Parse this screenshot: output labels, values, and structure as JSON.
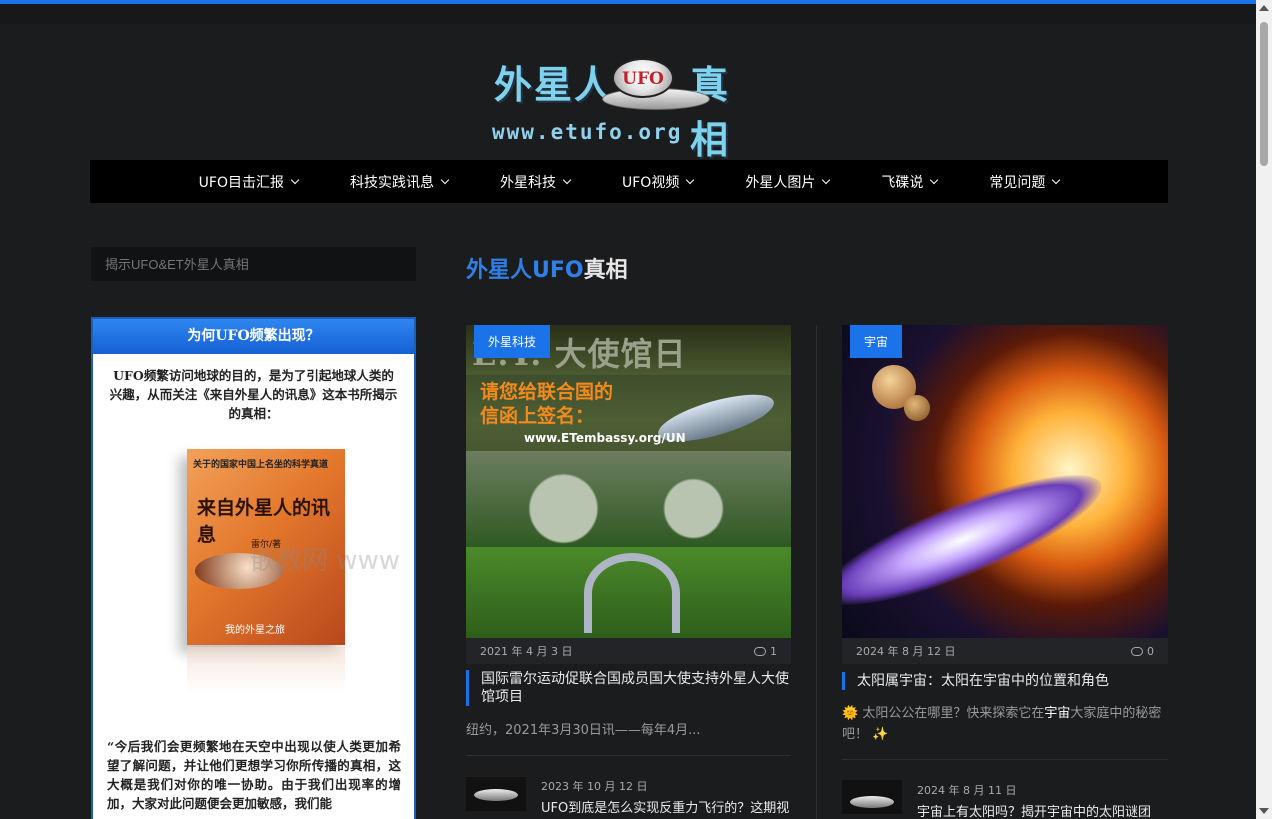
{
  "site": {
    "logo_cn_left": "外星人",
    "logo_badge": "UFO",
    "logo_cn_right": "真相",
    "logo_url": "www.etufo.org"
  },
  "nav": [
    {
      "label": "UFO目击汇报"
    },
    {
      "label": "科技实践讯息"
    },
    {
      "label": "外星科技"
    },
    {
      "label": "UFO视频"
    },
    {
      "label": "外星人图片"
    },
    {
      "label": "飞碟说"
    },
    {
      "label": "常见问题"
    }
  ],
  "sidebar": {
    "search_placeholder": "揭示UFO&ET外星人真相",
    "widget_title": "为何UFO频繁出现？",
    "widget_intro": "UFO频繁访问地球的目的，是为了引起地球人类的兴趣，从而关注《来自外星人的讯息》这本书所揭示的真相：",
    "book_top": "关于的国家中国上名坐的科学真道",
    "book_title": "来自外星人的讯息",
    "book_author": "雷尔/著",
    "book_subtitle": "我的外星之旅",
    "widget_quote": "“今后我们会更频繁地在天空中出现以使人类更加希望了解问题，并让他们更想学习你所传播的真相，这大概是我们对你的唯一协助。由于我们出现率的增加，大家对此问题便会更加敏感，我们能"
  },
  "watermark": "嵌教网  www",
  "main": {
    "section_title_hl": "外星人UFO",
    "section_title_rest": "真相",
    "cards": [
      {
        "badge": "外星科技",
        "img_header": "E.T. 大使馆日",
        "img_line2": "请您给联合国的",
        "img_line3": "信函上签名：",
        "img_url": "www.ETembassy.org/UN",
        "date": "2021 年 4 月 3 日",
        "comments": "1",
        "title": "国际雷尔运动促联合国成员国大使支持外星人大使馆项目",
        "excerpt": "纽约，2021年3月30日讯——每年4月..."
      },
      {
        "badge": "宇宙",
        "date": "2024 年 8 月 12 日",
        "comments": "0",
        "title": "太阳属宇宙：太阳在宇宙中的位置和角色",
        "excerpt_pre": "🌞 太阳公公在哪里？快来探索它在",
        "excerpt_bold": "宇宙",
        "excerpt_post": "大家庭中的秘密吧！ ✨"
      }
    ],
    "small_posts": [
      {
        "date": "2023 年 10 月 12 日",
        "title": "UFO到底是怎么实现反重力飞行的？这期视"
      },
      {
        "date": "2024 年 8 月 11 日",
        "title": "宇宙上有太阳吗？揭开宇宙中的太阳谜团"
      }
    ]
  },
  "colors": {
    "accent": "#1a73e8",
    "background": "#1b1c1e",
    "nav": "#000000"
  }
}
